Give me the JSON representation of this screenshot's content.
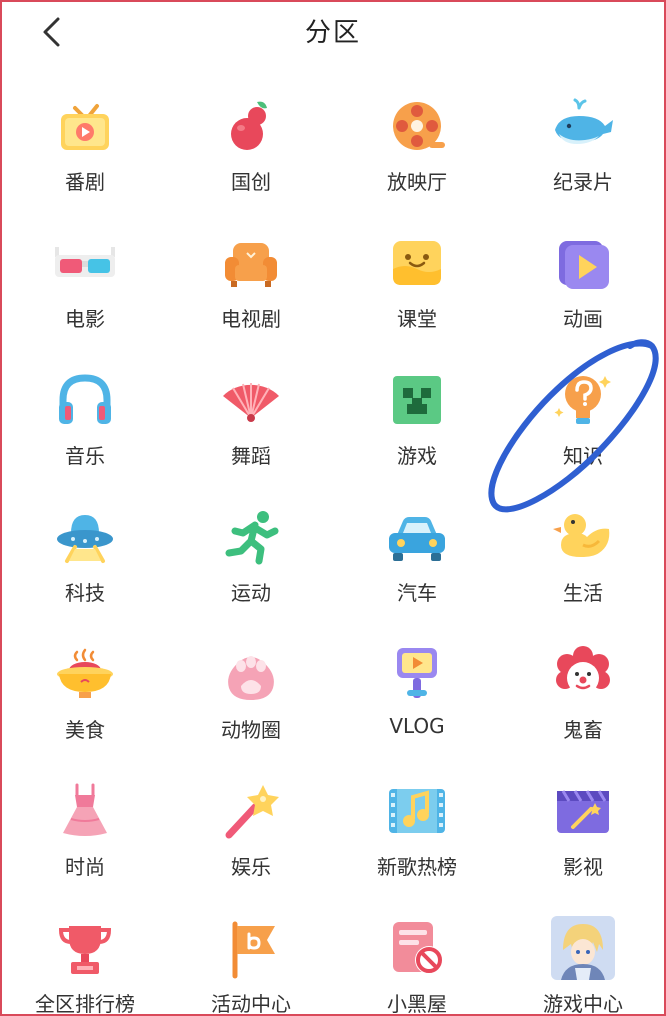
{
  "header": {
    "title": "分区",
    "back_icon": "chevron-left-icon"
  },
  "colors": {
    "frame_border": "#d94a5a",
    "annotation_stroke": "#2f5fd1",
    "label_text": "#333333"
  },
  "categories": [
    {
      "id": "fanju",
      "label": "番剧",
      "icon": "tv-icon"
    },
    {
      "id": "guochuang",
      "label": "国创",
      "icon": "gourd-icon"
    },
    {
      "id": "fangyingting",
      "label": "放映厅",
      "icon": "film-reel-icon"
    },
    {
      "id": "jilupian",
      "label": "纪录片",
      "icon": "whale-icon"
    },
    {
      "id": "dianying",
      "label": "电影",
      "icon": "3d-glasses-icon"
    },
    {
      "id": "dianshiju",
      "label": "电视剧",
      "icon": "sofa-icon"
    },
    {
      "id": "ketang",
      "label": "课堂",
      "icon": "smile-screen-icon"
    },
    {
      "id": "donghua",
      "label": "动画",
      "icon": "play-box-icon"
    },
    {
      "id": "yinyue",
      "label": "音乐",
      "icon": "headphones-icon"
    },
    {
      "id": "wudao",
      "label": "舞蹈",
      "icon": "fan-icon"
    },
    {
      "id": "youxi",
      "label": "游戏",
      "icon": "creeper-icon"
    },
    {
      "id": "zhishi",
      "label": "知识",
      "icon": "question-bulb-icon"
    },
    {
      "id": "keji",
      "label": "科技",
      "icon": "ufo-icon"
    },
    {
      "id": "yundong",
      "label": "运动",
      "icon": "runner-icon"
    },
    {
      "id": "qiche",
      "label": "汽车",
      "icon": "car-icon"
    },
    {
      "id": "shenghuo",
      "label": "生活",
      "icon": "duck-icon"
    },
    {
      "id": "meishi",
      "label": "美食",
      "icon": "hotpot-icon"
    },
    {
      "id": "dongwuquan",
      "label": "动物圈",
      "icon": "paw-icon"
    },
    {
      "id": "vlog",
      "label": "VLOG",
      "icon": "camera-stick-icon"
    },
    {
      "id": "guichu",
      "label": "鬼畜",
      "icon": "clown-icon"
    },
    {
      "id": "shishang",
      "label": "时尚",
      "icon": "dress-icon"
    },
    {
      "id": "yule",
      "label": "娱乐",
      "icon": "star-wand-icon"
    },
    {
      "id": "xingerebang",
      "label": "新歌热榜",
      "icon": "music-note-film-icon"
    },
    {
      "id": "yingshi",
      "label": "影视",
      "icon": "clapper-wand-icon"
    },
    {
      "id": "paihangbang",
      "label": "全区排行榜",
      "icon": "trophy-icon"
    },
    {
      "id": "huodong",
      "label": "活动中心",
      "icon": "flag-icon"
    },
    {
      "id": "xiaoheiwu",
      "label": "小黑屋",
      "icon": "ban-card-icon"
    },
    {
      "id": "youxizhongxin",
      "label": "游戏中心",
      "icon": "anime-avatar-icon"
    }
  ]
}
